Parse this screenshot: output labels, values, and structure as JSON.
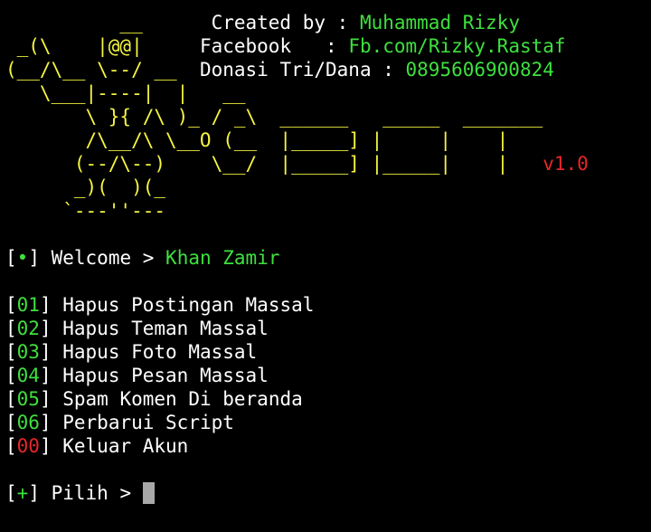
{
  "colors": {
    "background": "#000000",
    "ascii_art": "#f5f542",
    "text": "#ffffff",
    "highlight": "#3ee03e",
    "exit_number": "#e8262a",
    "version": "#e8262a",
    "cursor": "#a8a8a8"
  },
  "banner": {
    "art": [
      "          __      ",
      " _(\\    |@@|     ",
      "(__/\\__ \\--/ __  ",
      "   \\___|----|  |   __",
      "       \\ }{ /\\ )_ / _\\  ______   _____  _______",
      "       /\\__/\\ \\__O (__  |_____] |     |    |",
      "      (--/\\--)    \\__/  |_____] |_____|    |",
      "      _)(  )(_",
      "     `---''---"
    ],
    "info": [
      {
        "label": "Created by : ",
        "value": "Muhammad Rizky"
      },
      {
        "label": "Facebook   : ",
        "value": "Fb.com/Rizky.Rastaf"
      },
      {
        "label": "Donasi Tri/Dana : ",
        "value": "0895606900824"
      }
    ],
    "version": "v1.0"
  },
  "welcome": {
    "bullet": "•",
    "label": " Welcome > ",
    "name": "Khan Zamir"
  },
  "menu": [
    {
      "number": "01",
      "label": "Hapus Postingan Massal",
      "color": "green"
    },
    {
      "number": "02",
      "label": "Hapus Teman Massal",
      "color": "green"
    },
    {
      "number": "03",
      "label": "Hapus Foto Massal",
      "color": "green"
    },
    {
      "number": "04",
      "label": "Hapus Pesan Massal",
      "color": "green"
    },
    {
      "number": "05",
      "label": "Spam Komen Di beranda",
      "color": "green"
    },
    {
      "number": "06",
      "label": "Perbarui Script",
      "color": "green"
    },
    {
      "number": "00",
      "label": "Keluar Akun",
      "color": "red"
    }
  ],
  "prompt": {
    "symbol": "+",
    "label": " Pilih > ",
    "input_value": ""
  }
}
